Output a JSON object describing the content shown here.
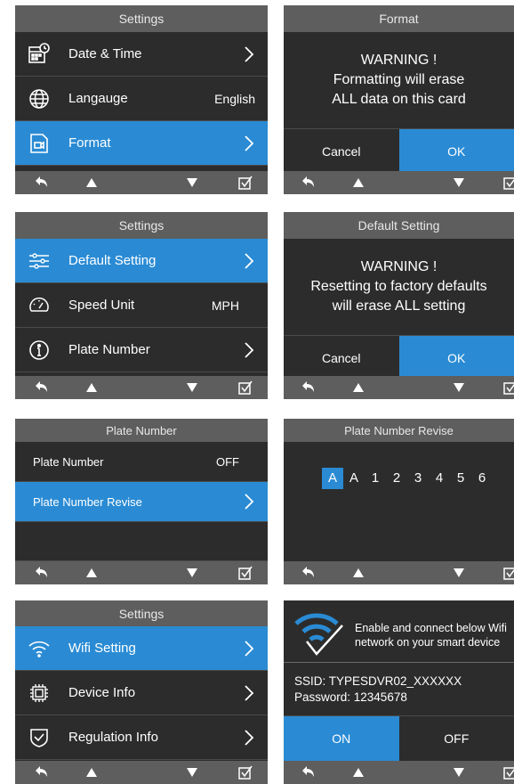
{
  "colors": {
    "accent": "#2a8bd4",
    "panel": "#2c2c2c",
    "bar": "#5e5e5e"
  },
  "nav": {
    "icons": [
      "back-arrow-icon",
      "up-triangle-icon",
      "down-triangle-icon",
      "check-box-icon"
    ]
  },
  "s1": {
    "title": "Settings",
    "items": [
      {
        "icon": "calendar-clock-icon",
        "label": "Date & Time"
      },
      {
        "icon": "globe-icon",
        "label": "Langauge",
        "value": "English"
      },
      {
        "icon": "video-card-icon",
        "label": "Format"
      }
    ]
  },
  "s2": {
    "title": "Format",
    "warn1": "WARNING !",
    "warn2": "Formatting will erase",
    "warn3": "ALL data on this card",
    "cancel": "Cancel",
    "ok": "OK"
  },
  "s3": {
    "title": "Settings",
    "items": [
      {
        "icon": "sliders-icon",
        "label": "Default Setting"
      },
      {
        "icon": "speedometer-icon",
        "label": "Speed Unit",
        "value": "MPH"
      },
      {
        "icon": "info-icon",
        "label": "Plate Number"
      }
    ]
  },
  "s4": {
    "title": "Default Setting",
    "warn1": "WARNING !",
    "warn2": "Resetting to factory defaults",
    "warn3": "will erase ALL setting",
    "cancel": "Cancel",
    "ok": "OK"
  },
  "s5": {
    "title": "Plate Number",
    "items": [
      {
        "label": "Plate Number",
        "value": "OFF"
      },
      {
        "label": "Plate Number Revise"
      }
    ]
  },
  "s6": {
    "title": "Plate Number Revise",
    "chars": [
      "A",
      "A",
      "1",
      "2",
      "3",
      "4",
      "5",
      "6"
    ]
  },
  "s7": {
    "title": "Settings",
    "items": [
      {
        "icon": "wifi-icon",
        "label": "Wifi Setting"
      },
      {
        "icon": "chip-icon",
        "label": "Device Info"
      },
      {
        "icon": "shield-check-icon",
        "label": "Regulation Info"
      }
    ]
  },
  "s8": {
    "info1": "Enable and connect below Wifi",
    "info2": "network on your smart device",
    "ssid": "SSID:  TYPESDVR02_XXXXXX",
    "password": "Password:  12345678",
    "on": "ON",
    "off": "OFF"
  }
}
